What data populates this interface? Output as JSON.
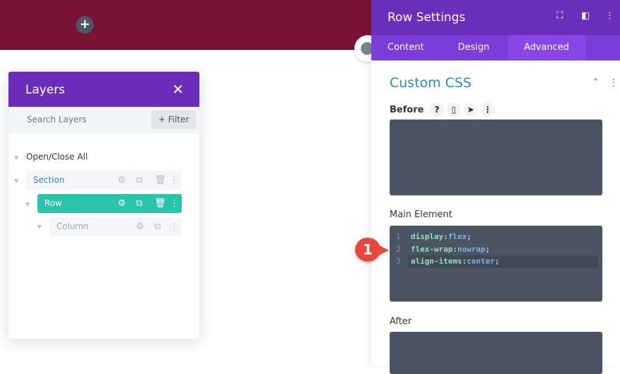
{
  "canvas": {
    "add_icon": "plus-icon"
  },
  "layers": {
    "title": "Layers",
    "search_placeholder": "Search Layers",
    "filter_label": "Filter",
    "open_close_all": "Open/Close All",
    "items": [
      {
        "label": "Section"
      },
      {
        "label": "Row"
      },
      {
        "label": "Column"
      }
    ]
  },
  "settings": {
    "title": "Row Settings",
    "tabs": [
      "Content",
      "Design",
      "Advanced"
    ],
    "active_tab": "Advanced",
    "section_title": "Custom CSS",
    "before_label": "Before",
    "main_label": "Main Element",
    "after_label": "After",
    "code": [
      {
        "n": "1",
        "prop": "display",
        "val": "flex"
      },
      {
        "n": "2",
        "prop": "flex-wrap",
        "val": "nowrap"
      },
      {
        "n": "3",
        "prop": "align-items",
        "val": "center"
      }
    ]
  },
  "callout": "1",
  "colors": {
    "purple": "#6b2db8",
    "green": "#29c4a9",
    "maroon": "#7a1436",
    "callout": "#e8473f"
  }
}
